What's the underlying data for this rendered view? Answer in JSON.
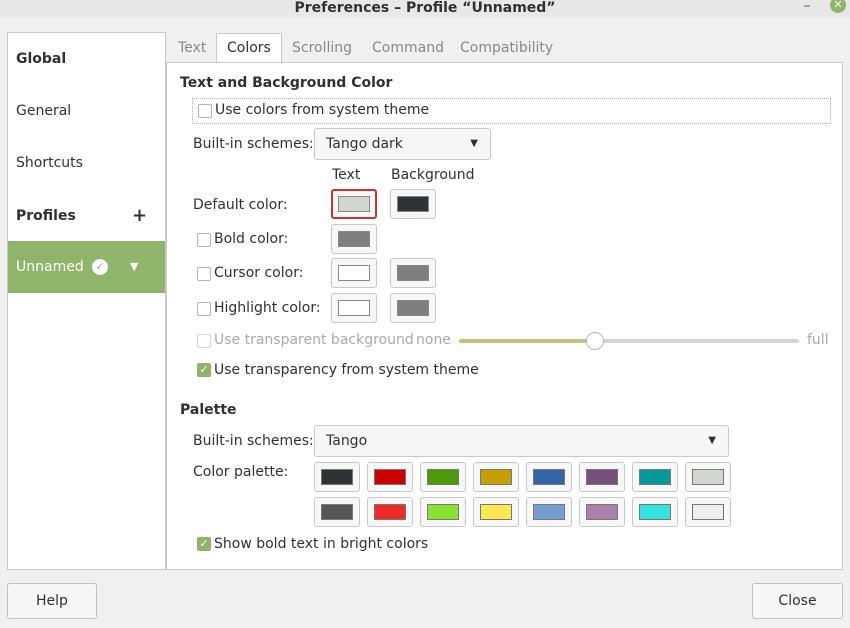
{
  "window": {
    "title": "Preferences – Profile “Unnamed”"
  },
  "sidebar": {
    "global": "Global",
    "general": "General",
    "shortcuts": "Shortcuts",
    "profiles": "Profiles",
    "profiles_add": "+",
    "profile_selected": "Unnamed"
  },
  "tabs": [
    "Text",
    "Colors",
    "Scrolling",
    "Command",
    "Compatibility"
  ],
  "colors": {
    "section_title": "Text and Background Color",
    "use_system_colors": "Use colors from system theme",
    "builtin_label": "Built-in schemes:",
    "builtin_value": "Tango dark",
    "col_text": "Text",
    "col_background": "Background",
    "default_color": "Default color:",
    "bold_color": "Bold color:",
    "cursor_color": "Cursor color:",
    "highlight_color": "Highlight color:",
    "transparent_bg": "Use transparent background",
    "none": "none",
    "full": "full",
    "transparency_level": 0.4,
    "use_system_transparency": "Use transparency from system theme",
    "swatches": {
      "default_text": "#d3d7cf",
      "default_bg": "#2e3436",
      "bold": "#7f7f7f",
      "cursor_text": "#ffffff",
      "cursor_bg": "#7f7f7f",
      "highlight_text": "#ffffff",
      "highlight_bg": "#7f7f7f"
    }
  },
  "palette": {
    "section_title": "Palette",
    "builtin_label": "Built-in schemes:",
    "builtin_value": "Tango",
    "palette_label": "Color palette:",
    "row1": [
      "#2e3436",
      "#cc0000",
      "#4e9a06",
      "#c4a000",
      "#3465a4",
      "#75507b",
      "#06989a",
      "#d3d7cf"
    ],
    "row2": [
      "#555753",
      "#ef2929",
      "#8ae234",
      "#fce94f",
      "#729fcf",
      "#ad7fa8",
      "#34e2e2",
      "#eeeeec"
    ],
    "bold_bright": "Show bold text in bright colors"
  },
  "footer": {
    "help": "Help",
    "close": "Close"
  }
}
